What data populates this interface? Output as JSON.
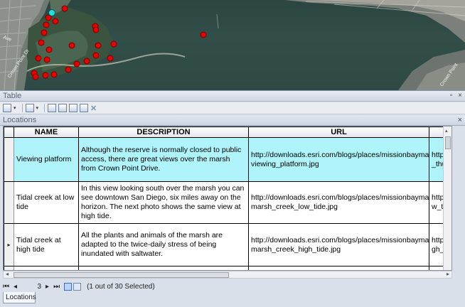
{
  "map": {
    "road_labels": [
      "Crown Point Dr",
      "Ave",
      "Crown Point"
    ],
    "colors": {
      "point": "#e60000",
      "selected_point": "#22e0e0"
    }
  },
  "table_window": {
    "title": "Table",
    "buttons": {
      "restore": "▫",
      "close": "×"
    },
    "toolbar_icons": [
      "table-options-icon",
      "related-tables-icon",
      "select-by-attributes-icon",
      "switch-selection-icon",
      "clear-selection-icon",
      "zoom-to-selected-icon",
      "delete-selected-icon"
    ],
    "tab": {
      "label": "Locations",
      "close": "×"
    }
  },
  "grid": {
    "columns": [
      "NAME",
      "DESCRIPTION",
      "URL",
      ""
    ],
    "rows": [
      {
        "marker": "",
        "name": "Viewing platform",
        "description": "Although the reserve is normally closed to public access, there are great views over the marsh from Crown Point Drive.",
        "url_line1": "http://downloads.esri.com/blogs/places/missionbaymarsh/",
        "url_line2": "viewing_platform.jpg",
        "extra_line1": "http://d",
        "extra_line2": "_thumb",
        "selected": true
      },
      {
        "marker": "",
        "name": "Tidal creek at low tide",
        "description": "In this view looking south over the marsh you can see downtown San Diego, six miles away on the horizon. The next photo shows the same view at high tide.",
        "url_line1": "http://downloads.esri.com/blogs/places/missionbaymarsh/",
        "url_line2": "marsh_creek_low_tide.jpg",
        "extra_line1": "http://d",
        "extra_line2": "w_tide_",
        "selected": false
      },
      {
        "marker": "▸",
        "name": "Tidal creek at high tide",
        "description": "All the plants and animals of the marsh are adapted to the twice-daily stress of being inundated with saltwater.",
        "url_line1": "http://downloads.esri.com/blogs/places/missionbaymarsh/",
        "url_line2": "marsh_creek_high_tide.jpg",
        "extra_line1": "http://d",
        "extra_line2": "gh_tide",
        "selected": false
      }
    ]
  },
  "navigation": {
    "first": "⏮",
    "prev": "◂",
    "record": "3",
    "next": "▸",
    "last": "⏭",
    "status": "(1 out of 30 Selected)"
  },
  "bottom_tab": {
    "label": "Locations"
  }
}
